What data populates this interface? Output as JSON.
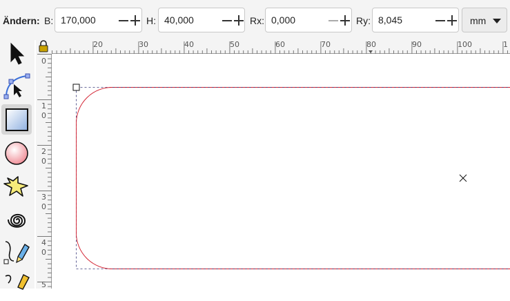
{
  "toolbar": {
    "change_label": "Ändern:",
    "fields": [
      {
        "label": "B:",
        "value": "170,000"
      },
      {
        "label": "H:",
        "value": "40,000"
      },
      {
        "label": "Rx:",
        "value": "0,000"
      },
      {
        "label": "Ry:",
        "value": "8,045"
      }
    ],
    "unit": "mm"
  },
  "tools": [
    {
      "name": "selector-tool",
      "icon": "arrow-icon"
    },
    {
      "name": "node-tool",
      "icon": "node-edit-icon"
    },
    {
      "name": "rectangle-tool",
      "icon": "rectangle-icon",
      "active": true
    },
    {
      "name": "ellipse-tool",
      "icon": "circle-icon"
    },
    {
      "name": "star-tool",
      "icon": "star-icon"
    },
    {
      "name": "spiral-tool",
      "icon": "spiral-icon"
    },
    {
      "name": "pen-tool",
      "icon": "pen-icon"
    },
    {
      "name": "calligraphy-tool",
      "icon": "calligraphy-icon"
    }
  ],
  "ruler": {
    "horizontal_labels": [
      "20",
      "30",
      "40",
      "50",
      "60",
      "70",
      "80",
      "90",
      "100",
      "1"
    ],
    "vertical_labels": [
      "0",
      "1",
      "0",
      "2",
      "0",
      "3",
      "0",
      "4",
      "0",
      "5"
    ],
    "lock_icon": "lock-icon"
  },
  "colors": {
    "path_stroke": "#d11a2a",
    "bbox_dash": "#3a3a7a",
    "tool_active_bg": "#d6d6d6"
  }
}
